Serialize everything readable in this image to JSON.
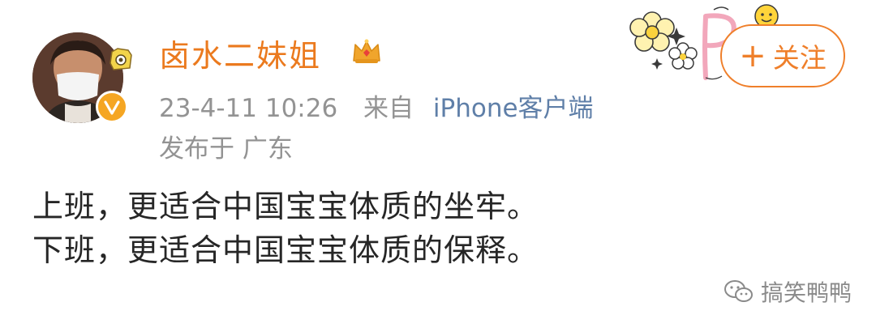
{
  "post": {
    "username": "卤水二妹姐",
    "timestamp": "23-4-11 10:26",
    "via_prefix": "来自",
    "source": "iPhone客户端",
    "location": "发布于 广东",
    "content_lines": [
      "上班，更适合中国宝宝体质的坐牢。",
      "下班，更适合中国宝宝体质的保释。"
    ]
  },
  "actions": {
    "follow_label": "关注"
  },
  "watermark": {
    "label": "搞笑鸭鸭"
  },
  "colors": {
    "username": "#eb7a1e",
    "follow_accent": "#ef7f2a",
    "meta_gray": "#939393",
    "source_blue": "#5f7fa8",
    "body_text": "#262626",
    "verified_badge": "#f5a623"
  },
  "icons": [
    "avatar",
    "verified-badge-icon",
    "camera-sticker-icon",
    "crown-member-icon",
    "flower-decoration",
    "wechat-icon"
  ]
}
